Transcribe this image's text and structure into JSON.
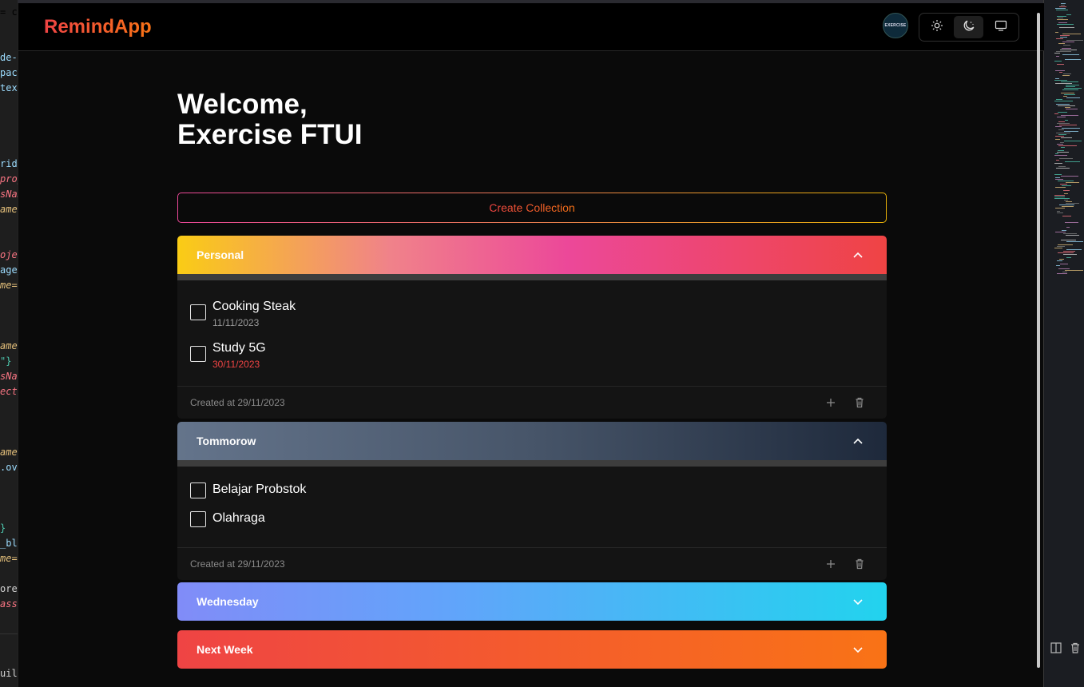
{
  "app": {
    "brand": "RemindApp",
    "avatar_text": "EXERCISE",
    "theme_options": [
      "light-icon",
      "dark-icon",
      "system-icon"
    ],
    "active_theme": "dark"
  },
  "welcome": {
    "line1": "Welcome,",
    "line2": "Exercise FTUI"
  },
  "create_button": "Create Collection",
  "collections": [
    {
      "name": "Personal",
      "expanded": true,
      "gradient": [
        "#facc15",
        "#ec4899",
        "#ef4444"
      ],
      "tasks": [
        {
          "name": "Cooking Steak",
          "date": "11/11/2023",
          "overdue": false
        },
        {
          "name": "Study 5G",
          "date": "30/11/2023",
          "overdue": true
        }
      ],
      "created": "Created at 29/11/2023"
    },
    {
      "name": "Tommorow",
      "expanded": true,
      "gradient": [
        "#64748b",
        "#1e293b"
      ],
      "tasks": [
        {
          "name": "Belajar Probstok"
        },
        {
          "name": "Olahraga"
        }
      ],
      "created": "Created at 29/11/2023"
    },
    {
      "name": "Wednesday",
      "expanded": false,
      "gradient": [
        "#818cf8",
        "#22d3ee"
      ]
    },
    {
      "name": "Next Week",
      "expanded": false,
      "gradient": [
        "#ef4444",
        "#f97316"
      ]
    }
  ],
  "editor_left_fragments": [
    {
      "text": "= c",
      "color": "#d4d4d4"
    },
    {
      "text": "de-",
      "color": "#9cdcfe"
    },
    {
      "text": "pace",
      "color": "#9cdcfe"
    },
    {
      "text": "text",
      "color": "#9cdcfe"
    },
    {
      "text": "rid",
      "color": "#9cdcfe"
    },
    {
      "text": "proj",
      "color": "#f97583"
    },
    {
      "text": "sNam",
      "color": "#f97583"
    },
    {
      "text": "ame=",
      "color": "#e5c07b"
    },
    {
      "text": "oje",
      "color": "#f97583"
    },
    {
      "text": "age",
      "color": "#9cdcfe"
    },
    {
      "text": "me=",
      "color": "#e5c07b"
    },
    {
      "text": "ame=",
      "color": "#e5c07b"
    },
    {
      "text": "\"}",
      "color": "#4ec9b0"
    },
    {
      "text": "sNa",
      "color": "#f97583"
    },
    {
      "text": "ect",
      "color": "#f97583"
    },
    {
      "text": "ame=",
      "color": "#e5c07b"
    },
    {
      "text": ".ov",
      "color": "#9cdcfe"
    },
    {
      "text": "}",
      "color": "#4ec9b0"
    },
    {
      "text": "_bl",
      "color": "#9cdcfe"
    },
    {
      "text": "me=",
      "color": "#e5c07b"
    },
    {
      "text": "ore",
      "color": "#d4d4d4"
    },
    {
      "text": "ass",
      "color": "#f97583"
    },
    {
      "text": "uild",
      "color": "#d4d4d4"
    }
  ]
}
